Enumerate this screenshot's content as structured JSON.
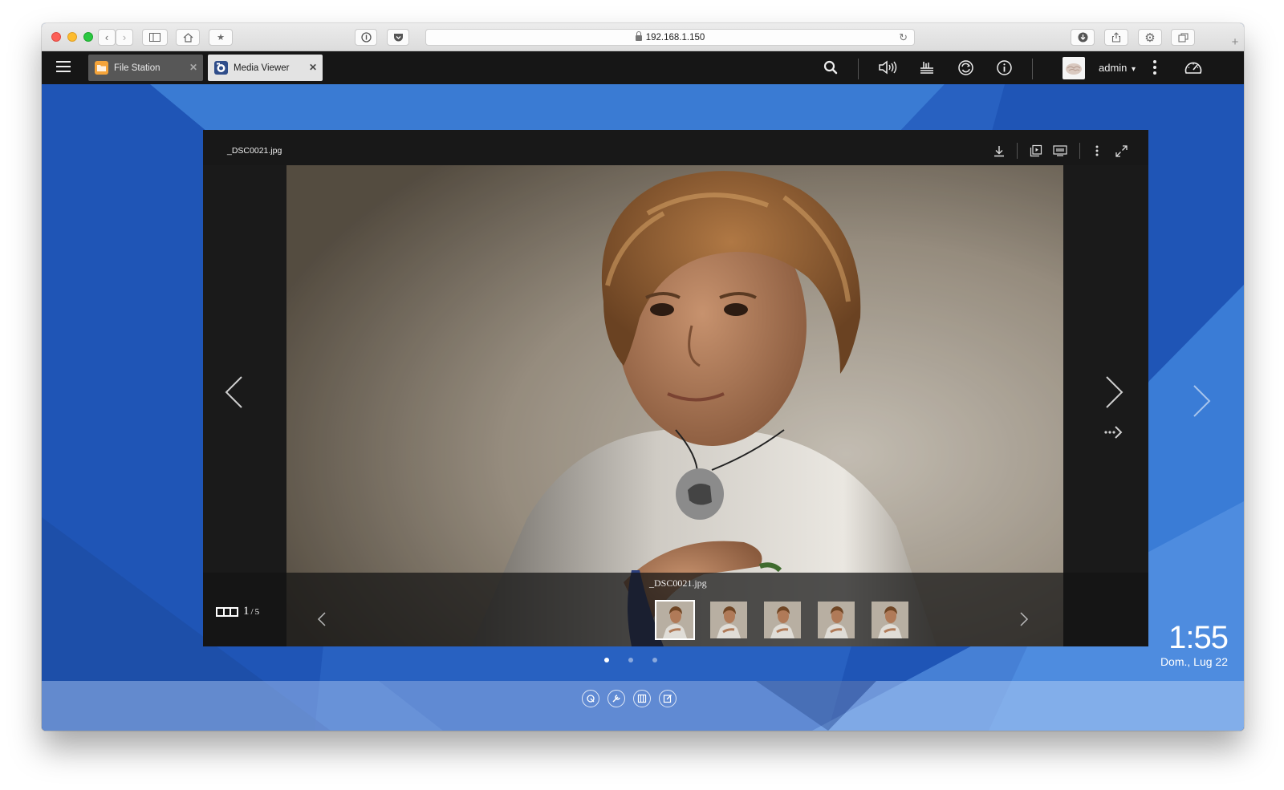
{
  "browser": {
    "url": "192.168.1.150"
  },
  "nas": {
    "tabs": [
      {
        "label": "File Station",
        "active": false,
        "icon_color": "#f5a43a"
      },
      {
        "label": "Media Viewer",
        "active": true,
        "icon_color": "#2f4d8a"
      }
    ],
    "username": "admin",
    "username_caret": "▾"
  },
  "viewer": {
    "filename": "_DSC0021.jpg",
    "strip_filename": "_DSC0021.jpg",
    "current": "1",
    "separator": "/",
    "total": "5",
    "thumbnails": [
      "thumb-1",
      "thumb-2",
      "thumb-3",
      "thumb-4",
      "thumb-5"
    ],
    "active_thumb": 0
  },
  "desktop": {
    "clock": "1:55",
    "date": "Dom., Lug 22",
    "pages": 3,
    "active_page": 0
  },
  "colors": {
    "desktop_bg": "#1f54b4",
    "navbar_bg": "#161616",
    "viewer_bg": "#1a1a1a"
  }
}
